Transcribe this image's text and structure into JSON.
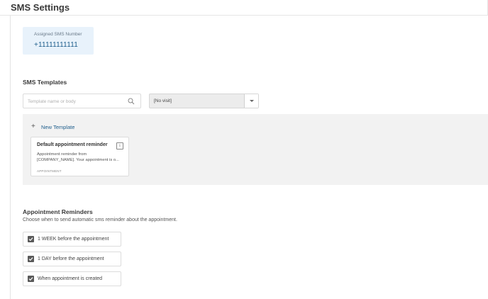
{
  "header": {
    "title": "SMS Settings"
  },
  "assigned_number": {
    "label": "Assigned SMS Number",
    "value": "+11111111111"
  },
  "templates_section": {
    "heading": "SMS Templates",
    "search": {
      "placeholder": "Template name or body",
      "value": "",
      "icon": "search-icon"
    },
    "visit_filter": {
      "selected": "[No visit]",
      "icon": "chevron-down-icon"
    },
    "new_template_label": "New Template",
    "templates": [
      {
        "title": "Default appointment reminder",
        "body_line1": "Appointment reminder from",
        "body_line2": "[COMPANY_NAME]. Your appointment is o...",
        "tag": "APPOINTMENT"
      }
    ]
  },
  "reminders_section": {
    "heading": "Appointment Reminders",
    "description": "Choose when to send automatic sms reminder about the appointment.",
    "options": [
      {
        "label": "1 WEEK before the appointment",
        "checked": true
      },
      {
        "label": "1 DAY before the appointment",
        "checked": true
      },
      {
        "label": "When appointment is created",
        "checked": true
      }
    ]
  },
  "colors": {
    "accent": "#1f5e8c",
    "assigned_card_bg": "#e8f2fb",
    "panel_bg": "#f2f2f2",
    "checkbox": "#5a5a5a"
  }
}
